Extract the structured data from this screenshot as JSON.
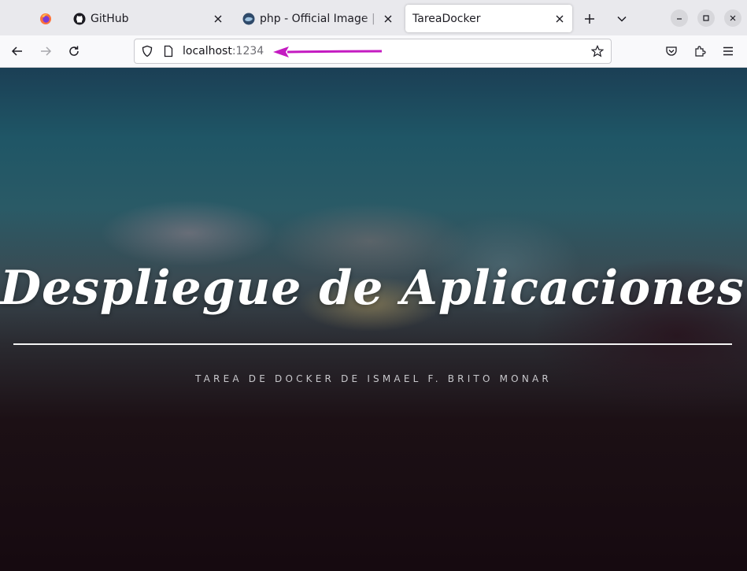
{
  "browser": {
    "tabs": [
      {
        "label": "",
        "icon": "firefox-icon"
      },
      {
        "label": "GitHub",
        "icon": "github-icon"
      },
      {
        "label": "php - Official Image | Do",
        "icon": "docker-icon"
      },
      {
        "label": "TareaDocker",
        "icon": "",
        "active": true
      }
    ],
    "url": {
      "host": "localhost",
      "port": ":1234"
    },
    "annotation_color": "#c41bc1",
    "tab_strip_color": "#e9e9ed"
  },
  "page": {
    "title": "Despliegue de Aplicaciones Web",
    "subtitle": "TAREA DE DOCKER DE ISMAEL F. BRITO MONAR"
  }
}
